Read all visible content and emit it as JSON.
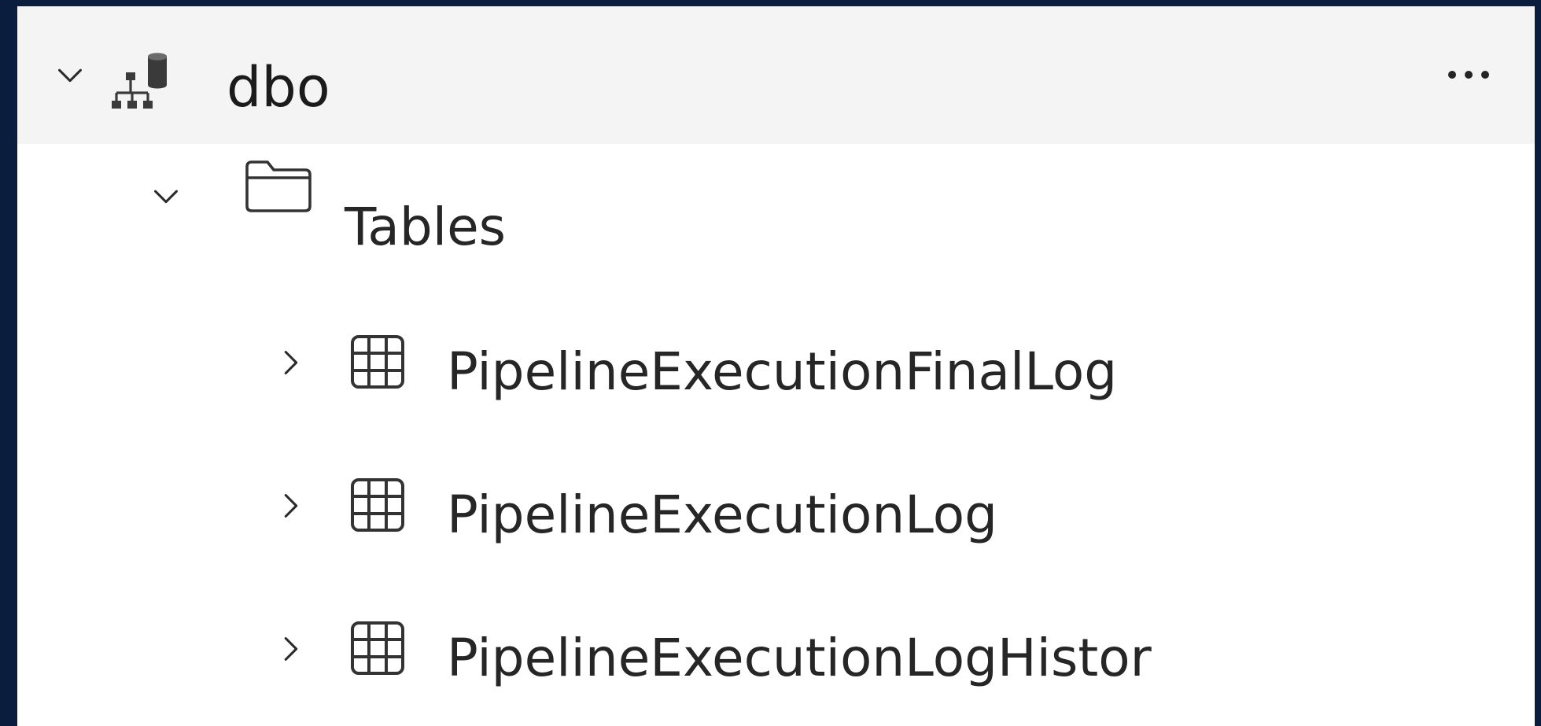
{
  "schema": {
    "label": "dbo",
    "icon": "schema-icon",
    "chevron": "chevron-down-icon",
    "more_icon": "more-options-icon"
  },
  "folder": {
    "label": "Tables",
    "icon": "folder-icon",
    "chevron": "chevron-down-icon"
  },
  "tables": [
    {
      "label": "PipelineExecutionFinalLog",
      "icon": "table-icon",
      "chevron": "chevron-right-icon"
    },
    {
      "label": "PipelineExecutionLog",
      "icon": "table-icon",
      "chevron": "chevron-right-icon"
    },
    {
      "label": "PipelineExecutionLogHistor",
      "icon": "table-icon",
      "chevron": "chevron-right-icon"
    }
  ],
  "colors": {
    "frame": "#0b1d3f",
    "panel": "#ffffff",
    "selected_row": "#f4f4f4",
    "text": "#262626"
  }
}
